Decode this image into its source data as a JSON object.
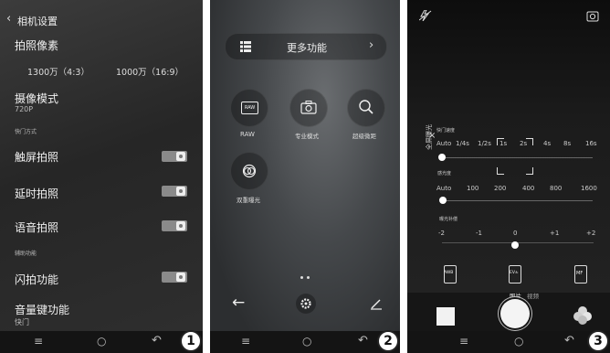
{
  "panel1": {
    "header_title": "相机设置",
    "photo_pixels_title": "拍照像素",
    "res_option_1": "1300万（4:3）",
    "res_option_2": "1000万（16:9）",
    "camera_mode_title": "摄像模式",
    "camera_mode_value": "720P",
    "shutter_section": "快门方式",
    "touch_shot": "触屏拍照",
    "timer_shot": "延时拍照",
    "voice_shot": "语音拍照",
    "aux_section": "辅助功能",
    "flash_shot": "闪拍功能",
    "volume_key_title": "音量键功能",
    "volume_key_value": "快门",
    "badge": "1"
  },
  "panel2": {
    "more_functions": "更多功能",
    "raw_label": "RAW",
    "pro_mode_label": "专业模式",
    "super_macro_label": "超级微距",
    "double_exposure_label": "双重曝光",
    "badge": "2"
  },
  "panel3": {
    "shutter_speed_label": "快门速度",
    "shutter_values": [
      "Auto",
      "1/4s",
      "1/2s",
      "1s",
      "2s",
      "4s",
      "8s",
      "16s"
    ],
    "side_label": "全屏曝光",
    "iso_label": "感光度",
    "iso_values": [
      "Auto",
      "100",
      "200",
      "400",
      "800",
      "1600"
    ],
    "exposure_label": "曝光补偿",
    "exposure_values": [
      "-2",
      "-1",
      "0",
      "+1",
      "+2"
    ],
    "awb_label": "AWB",
    "ev_label": "EV±",
    "mf_label": "MF",
    "photo_tab": "照片",
    "video_tab": "视频",
    "badge": "3"
  }
}
